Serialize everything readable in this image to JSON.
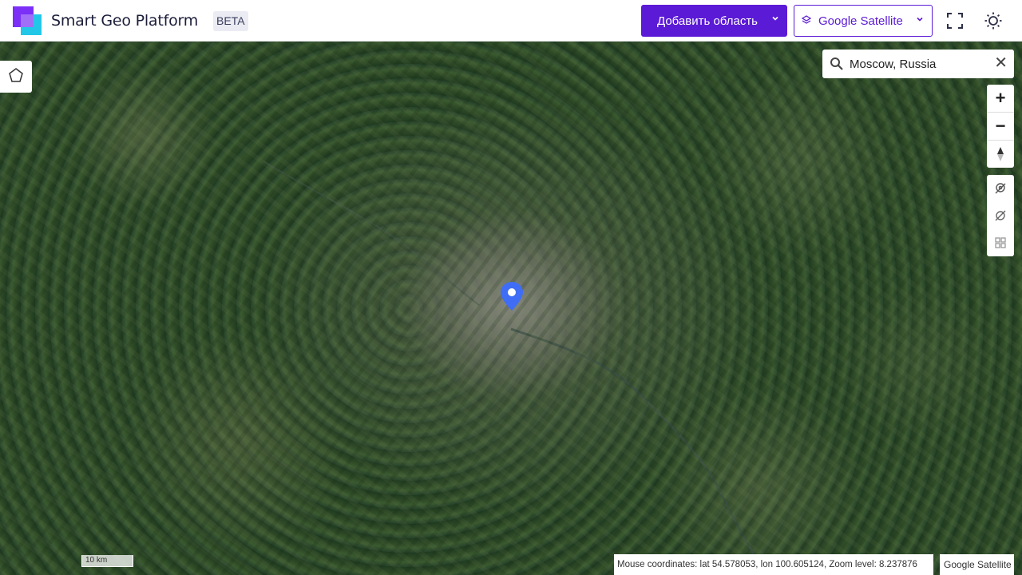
{
  "header": {
    "brand": "Smart Geo Platform",
    "badge": "BETA",
    "add_area_label": "Добавить область",
    "layer_label": "Google Satellite",
    "icons": {
      "logo": "logo-mark",
      "add_area_chevron": "chevron-down-icon",
      "layer_icon": "layers-icon",
      "layer_chevron": "chevron-down-icon",
      "fullscreen": "fullscreen-icon",
      "theme": "sun-icon"
    },
    "colors": {
      "primary": "#5b1ad6",
      "logo_purple": "#7b2ff7",
      "logo_cyan": "#22c7e8"
    }
  },
  "map": {
    "search": {
      "value": "Moscow, Russia",
      "icon": "search-icon",
      "clear_icon": "close-icon"
    },
    "draw_tool_icon": "pentagon-icon",
    "zoom_controls": {
      "zoom_in": "+",
      "zoom_out": "−",
      "compass_icon": "compass-icon"
    },
    "tools": [
      "geofence-icon",
      "hide-geofence-icon",
      "grid-icon"
    ],
    "marker_icon": "location-pin-icon",
    "marker_color": "#3f6df5",
    "scale_label": "10 km",
    "coords_text": "Mouse coordinates: lat 54.578053, lon 100.605124, Zoom level: 8.237876",
    "attribution": "Google Satellite"
  }
}
